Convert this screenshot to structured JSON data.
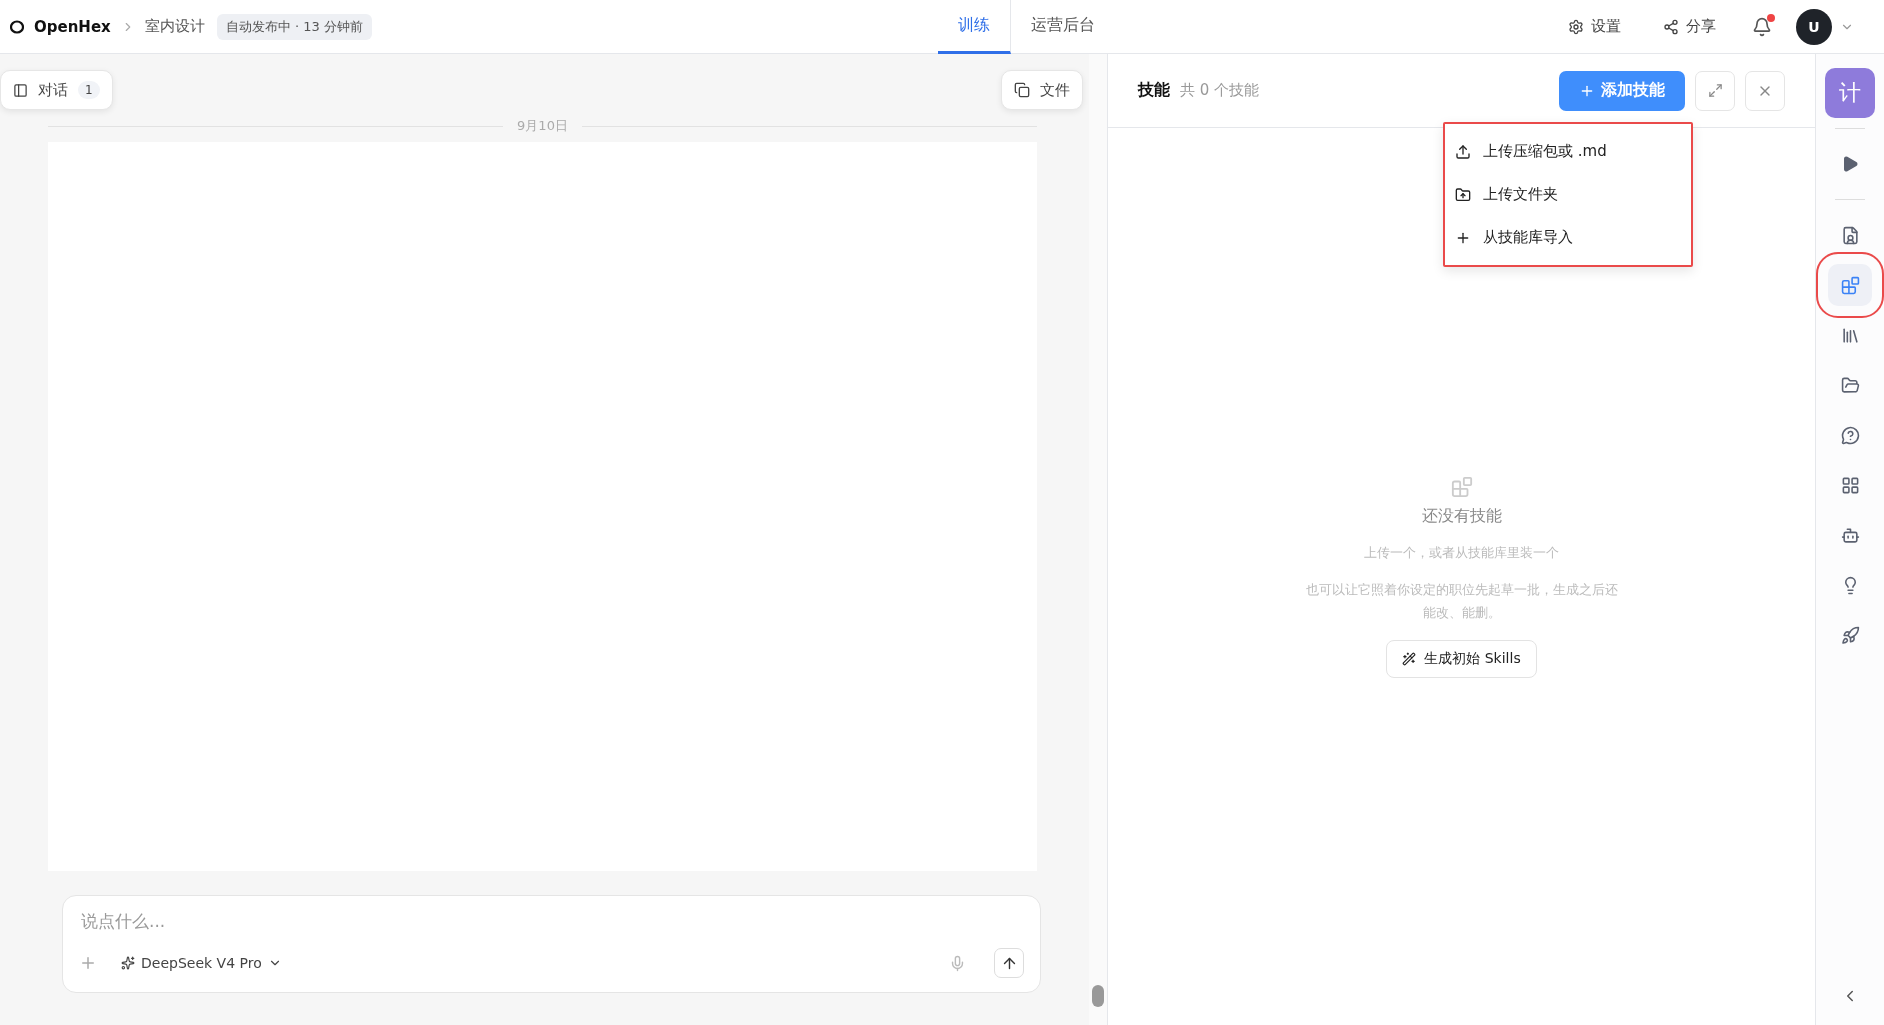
{
  "top_bar": {
    "brand": "OpenHex",
    "breadcrumb": "室内设计",
    "status_badge": "自动发布中 · 13 分钟前",
    "tabs": [
      {
        "label": "训练",
        "selected": true
      },
      {
        "label": "运营后台",
        "selected": false
      }
    ],
    "actions": [
      "设置",
      "分享"
    ],
    "notification_unread": true,
    "avatar": "U"
  },
  "chat": {
    "dialog_button": {
      "label": "对话",
      "count": "1"
    },
    "files_button": "文件",
    "date_divider": "9月10日",
    "input": {
      "placeholder": "说点什么...",
      "model": "DeepSeek V4 Pro"
    }
  },
  "skills_panel": {
    "title": "技能",
    "count": "共 0 个技能",
    "add_button": "添加技能",
    "menu": [
      "上传压缩包或 .md",
      "上传文件夹",
      "从技能库导入"
    ],
    "empty": {
      "title": "还没有技能",
      "line_1": "上传一个，或者从技能库里装一个",
      "line_2": "也可以让它照着你设定的职位先起草一批，生成之后还能改、能删。",
      "action": "生成初始 Skills"
    }
  },
  "rail": {
    "logo": "计",
    "items": [
      {
        "selected": false
      },
      {
        "selected": false
      },
      {
        "selected": true
      },
      {
        "selected": false
      },
      {
        "selected": false
      },
      {
        "selected": false
      },
      {
        "selected": false
      },
      {
        "selected": false
      },
      {
        "selected": false
      },
      {
        "selected": false
      }
    ]
  }
}
